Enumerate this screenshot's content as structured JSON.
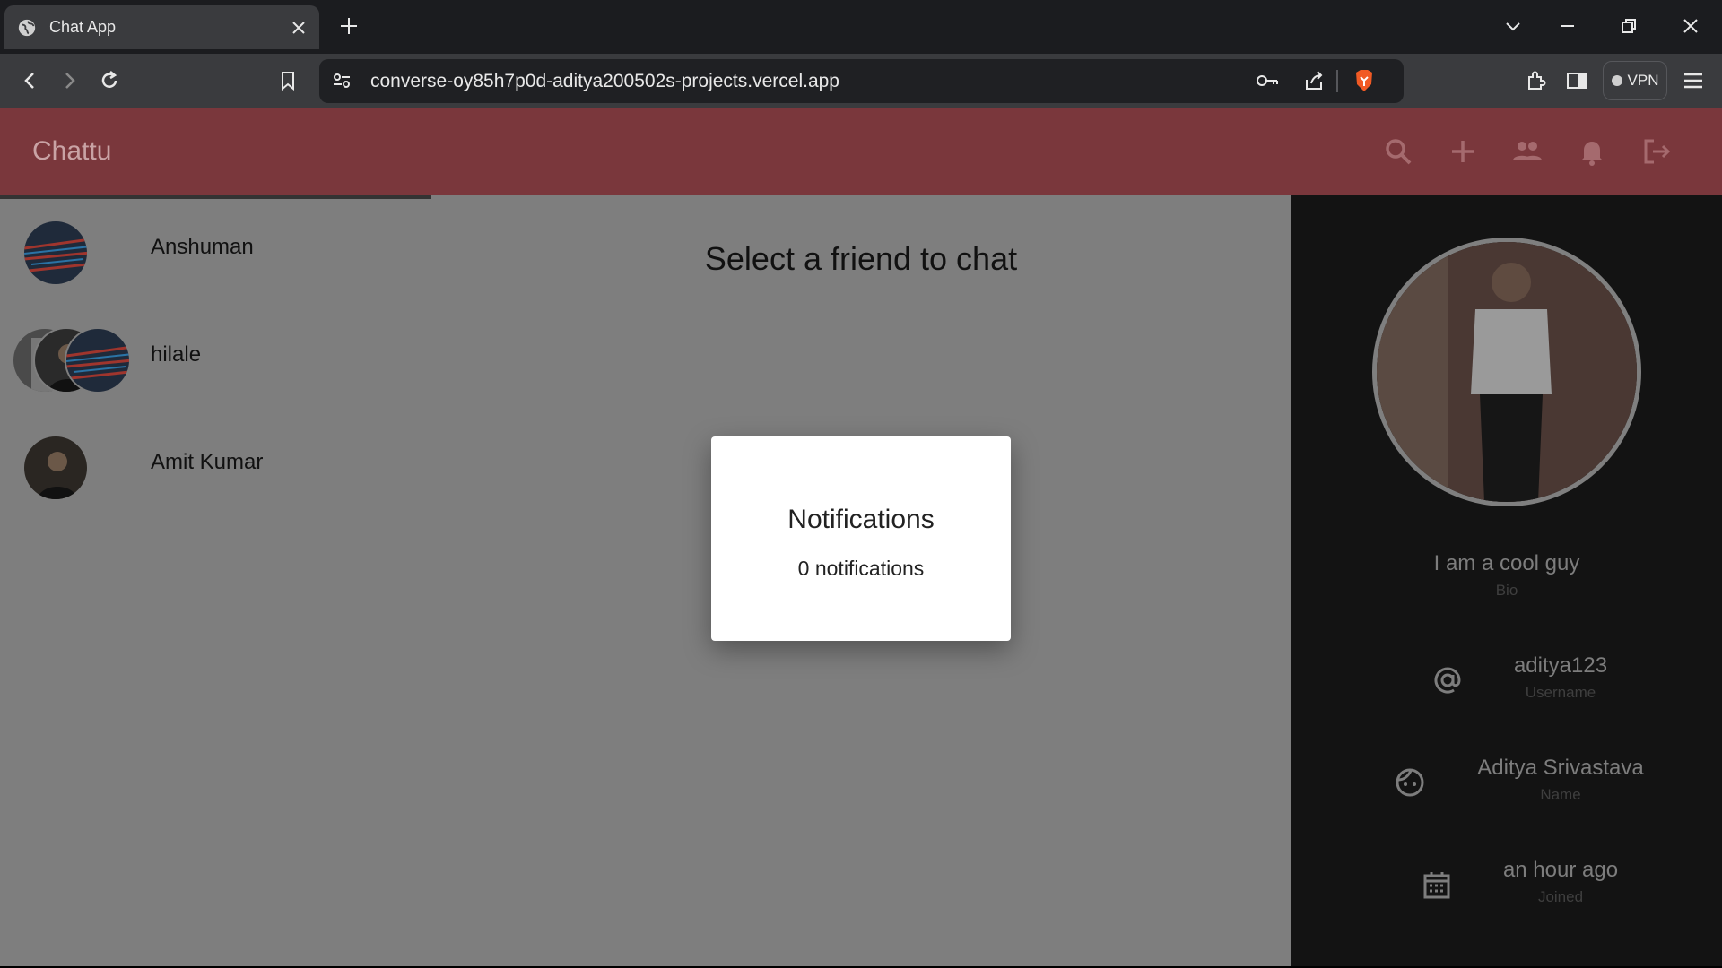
{
  "browser": {
    "tab_title": "Chat App",
    "url": "converse-oy85h7p0d-aditya200502s-projects.vercel.app",
    "vpn_label": "VPN"
  },
  "app": {
    "brand": "Chattu",
    "header_color": "#7a373c"
  },
  "chats": [
    {
      "name": "Anshuman"
    },
    {
      "name": "hilale"
    },
    {
      "name": "Amit Kumar"
    }
  ],
  "main": {
    "placeholder": "Select a friend to chat"
  },
  "profile": {
    "bio": "I am a cool guy",
    "bio_label": "Bio",
    "username": "aditya123",
    "username_label": "Username",
    "name": "Aditya Srivastava",
    "name_label": "Name",
    "joined": "an hour ago",
    "joined_label": "Joined"
  },
  "modal": {
    "title": "Notifications",
    "count_text": "0 notifications"
  }
}
